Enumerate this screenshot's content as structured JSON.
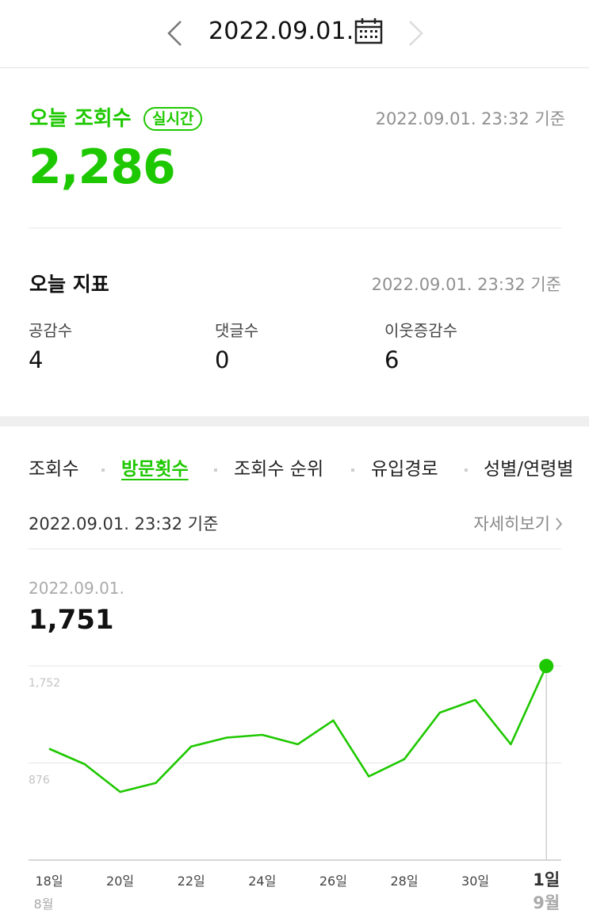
{
  "header": {
    "date": "2022.09.01."
  },
  "today_views": {
    "title": "오늘 조회수",
    "badge": "실시간",
    "timestamp": "2022.09.01. 23:32 기준",
    "value": "2,286"
  },
  "today_metrics": {
    "title": "오늘 지표",
    "timestamp": "2022.09.01. 23:32 기준",
    "items": [
      {
        "label": "공감수",
        "value": "4"
      },
      {
        "label": "댓글수",
        "value": "0"
      },
      {
        "label": "이웃증감수",
        "value": "6"
      }
    ]
  },
  "tabs": [
    {
      "label": "조회수",
      "active": false
    },
    {
      "label": "방문횟수",
      "active": true
    },
    {
      "label": "조회수 순위",
      "active": false
    },
    {
      "label": "유입경로",
      "active": false
    },
    {
      "label": "성별/연령별",
      "active": false
    }
  ],
  "visits": {
    "timestamp": "2022.09.01. 23:32 기준",
    "details_label": "자세히보기",
    "selected_date": "2022.09.01.",
    "selected_value": "1,751"
  },
  "colors": {
    "accent": "#1ec800",
    "muted": "#909090"
  },
  "chart_data": {
    "type": "line",
    "ylim": [
      0,
      1752
    ],
    "yticks": [
      876,
      1752
    ],
    "ytick_labels": [
      "876",
      "1,752"
    ],
    "x": [
      "8/18",
      "8/19",
      "8/20",
      "8/21",
      "8/22",
      "8/23",
      "8/24",
      "8/25",
      "8/26",
      "8/27",
      "8/28",
      "8/29",
      "8/30",
      "8/31",
      "9/1"
    ],
    "xtick_labels": [
      "18일",
      "",
      "20일",
      "",
      "22일",
      "",
      "24일",
      "",
      "26일",
      "",
      "28일",
      "",
      "30일",
      "",
      "1일"
    ],
    "month_labels": [
      {
        "index": 0,
        "label": "8월"
      },
      {
        "index": 14,
        "label": "9월"
      }
    ],
    "series": [
      {
        "values": [
          1005,
          865,
          615,
          695,
          1025,
          1105,
          1130,
          1045,
          1260,
          755,
          910,
          1330,
          1445,
          1045,
          1751
        ]
      }
    ],
    "highlight_index": 14
  }
}
